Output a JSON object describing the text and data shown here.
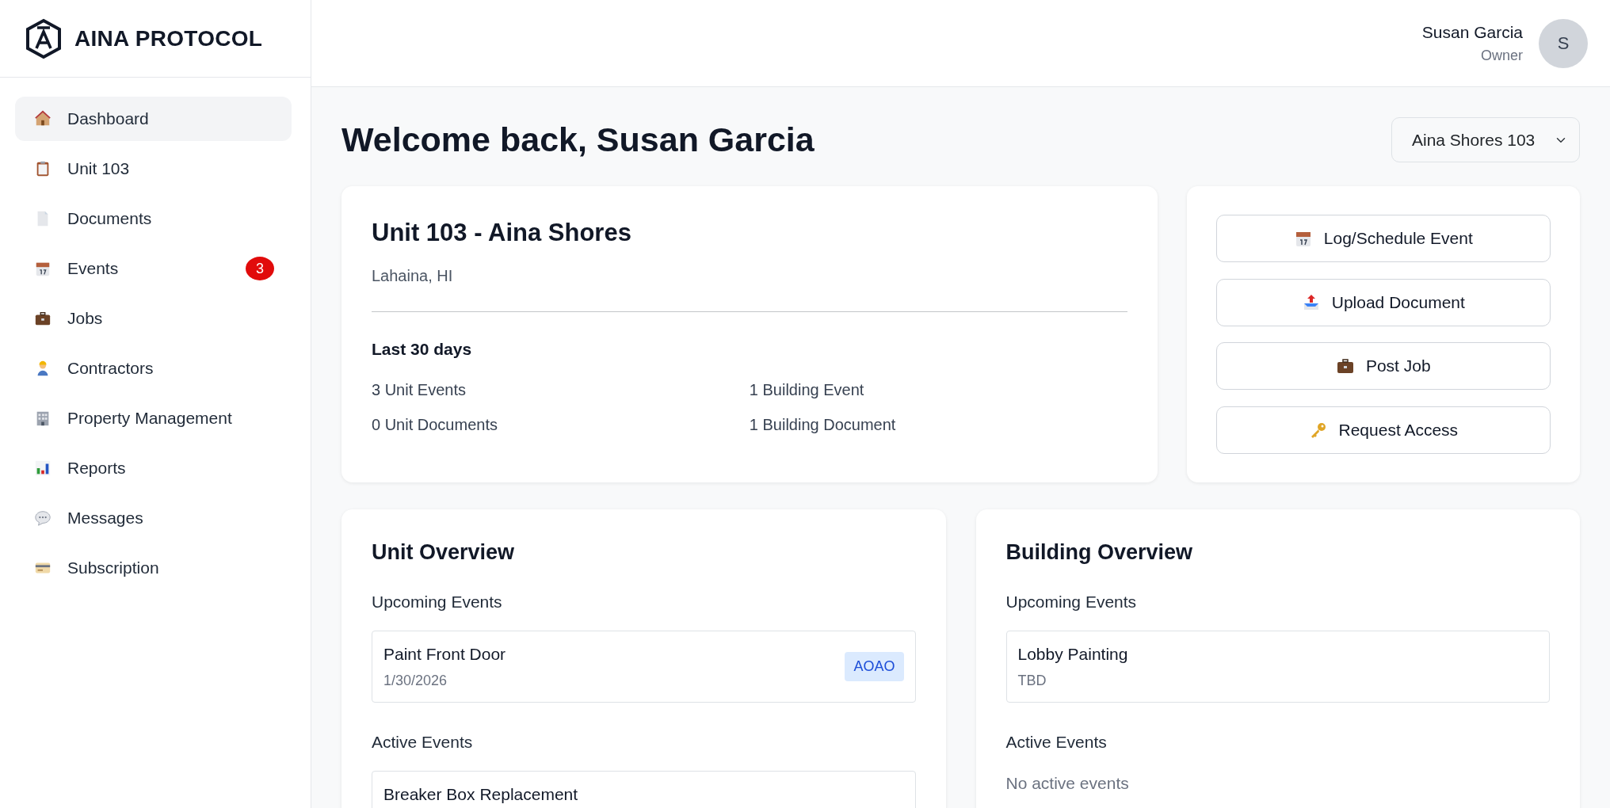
{
  "brand": {
    "name": "AINA PROTOCOL"
  },
  "sidebar": {
    "items": [
      {
        "label": "Dashboard",
        "selected": true
      },
      {
        "label": "Unit 103",
        "selected": false
      },
      {
        "label": "Documents",
        "selected": false
      },
      {
        "label": "Events",
        "selected": false,
        "badge": "3"
      },
      {
        "label": "Jobs",
        "selected": false
      },
      {
        "label": "Contractors",
        "selected": false
      },
      {
        "label": "Property Management",
        "selected": false
      },
      {
        "label": "Reports",
        "selected": false
      },
      {
        "label": "Messages",
        "selected": false
      },
      {
        "label": "Subscription",
        "selected": false
      }
    ]
  },
  "user": {
    "name": "Susan Garcia",
    "role": "Owner",
    "initial": "S"
  },
  "page_title": "Welcome back, Susan Garcia",
  "property_select": {
    "value": "Aina Shores 103"
  },
  "unit_card": {
    "title": "Unit 103 - Aina Shores",
    "location": "Lahaina, HI",
    "period": "Last 30 days",
    "stats": [
      "3 Unit Events",
      "1 Building Event",
      "0 Unit Documents",
      "1 Building Document"
    ]
  },
  "actions": [
    "Log/Schedule Event",
    "Upload Document",
    "Post Job",
    "Request Access"
  ],
  "unit_overview": {
    "title": "Unit Overview",
    "sections": [
      {
        "heading": "Upcoming Events",
        "events": [
          {
            "title": "Paint Front Door",
            "date": "1/30/2026",
            "tag": "AOAO"
          }
        ]
      },
      {
        "heading": "Active Events",
        "events": [
          {
            "title": "Breaker Box Replacement"
          }
        ]
      }
    ]
  },
  "building_overview": {
    "title": "Building Overview",
    "sections": [
      {
        "heading": "Upcoming Events",
        "events": [
          {
            "title": "Lobby Painting",
            "date": "TBD"
          }
        ]
      },
      {
        "heading": "Active Events",
        "empty": "No active events"
      }
    ]
  }
}
